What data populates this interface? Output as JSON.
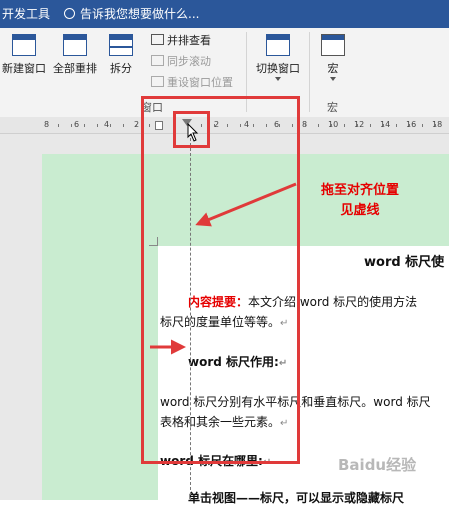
{
  "titlebar": {
    "tab_label": "开发工具",
    "tell_me": "告诉我您想要做什么..."
  },
  "ribbon": {
    "new_window": "新建窗口",
    "arrange_all": "全部重排",
    "split": "拆分",
    "view_side_by_side": "并排查看",
    "sync_scrolling": "同步滚动",
    "reset_window_position": "重设窗口位置",
    "switch_windows": "切换窗口",
    "macros": "宏",
    "group_window": "窗口",
    "group_macros": "宏"
  },
  "ruler": {
    "labels": [
      "8",
      "6",
      "4",
      "2",
      "2",
      "4",
      "6",
      "8",
      "10",
      "12",
      "14",
      "16",
      "18",
      "20"
    ]
  },
  "document": {
    "title": "word 标尺使",
    "summary_label": "内容提要：",
    "summary_text": "本文介绍 word 标尺的使用方法",
    "summary_line2": "标尺的度量单位等等。",
    "heading1": "word 标尺作用:",
    "para1_line1": "word 标尺分别有水平标尺和垂直标尺。word 标尺",
    "para1_line2": "表格和其余一些元素。",
    "heading2": "word 标尺在哪里:",
    "para2_line1": "单击视图——标尺，可以显示或隐藏标尺"
  },
  "annotation": {
    "line1": "拖至对齐位置",
    "line2": "见虚线"
  },
  "watermark": "Baidu经验",
  "colors": {
    "titlebar": "#2b579a",
    "annotation_red": "#e60000",
    "highlight_green": "#c9ecd0"
  }
}
